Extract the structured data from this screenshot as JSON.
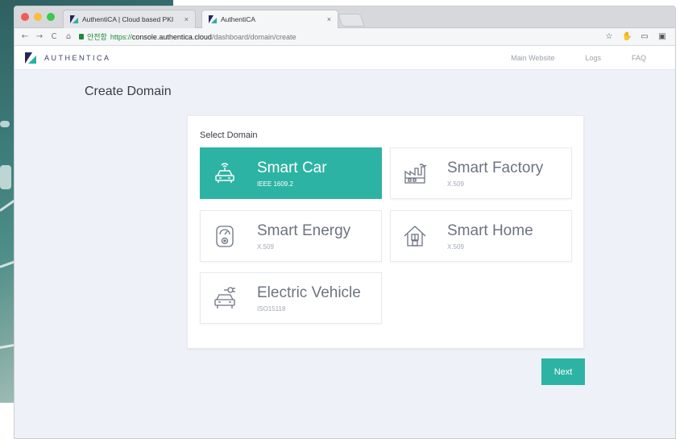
{
  "browser": {
    "tabs": [
      {
        "title": "AuthentiCA | Cloud based PKI",
        "close": "×"
      },
      {
        "title": "AuthentiCA",
        "close": "×"
      }
    ],
    "address": {
      "secure_label": "안전함",
      "protocol": "https://",
      "host": "console.authentica.cloud",
      "path": "/dashboard/domain/create"
    },
    "nav": {
      "back": "←",
      "forward": "→",
      "reload": "C",
      "home": "⌂"
    },
    "toolbar": {
      "star": "☆",
      "ext1": "✋",
      "ext2": "▭",
      "ext3": "▣"
    }
  },
  "app": {
    "brand_name": "AUTHENTICA",
    "nav": {
      "main_website": "Main Website",
      "logs": "Logs",
      "faq": "FAQ"
    },
    "page_title": "Create Domain",
    "panel_label": "Select Domain",
    "domains": [
      {
        "title": "Smart Car",
        "standard": "IEEE 1609.2",
        "icon": "car-antenna-icon",
        "selected": true
      },
      {
        "title": "Smart Factory",
        "standard": "X.509",
        "icon": "factory-icon",
        "selected": false
      },
      {
        "title": "Smart Energy",
        "standard": "X.509",
        "icon": "energy-meter-icon",
        "selected": false
      },
      {
        "title": "Smart Home",
        "standard": "X.509",
        "icon": "home-icon",
        "selected": false
      },
      {
        "title": "Electric Vehicle",
        "standard": "ISO15118",
        "icon": "ev-plug-icon",
        "selected": false
      }
    ],
    "next_label": "Next",
    "colors": {
      "accent": "#2db3a3",
      "brand_dark": "#24265a",
      "page_bg": "#eef1f8"
    }
  }
}
